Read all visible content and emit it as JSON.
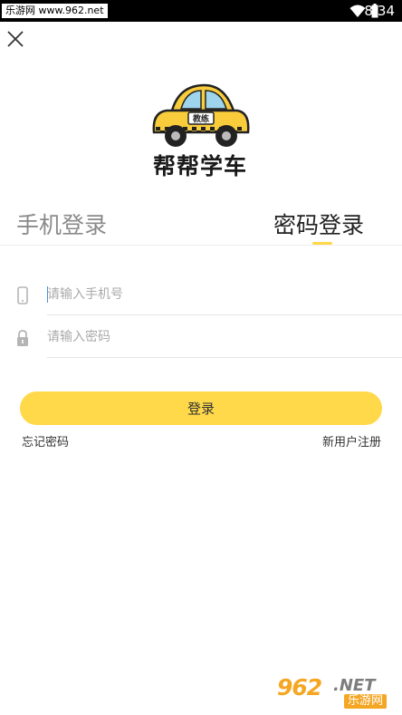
{
  "status_bar": {
    "source_label": "乐游网 www.962.net",
    "time": "8:34"
  },
  "logo": {
    "car_sign": "教练",
    "title": "帮帮学车"
  },
  "tabs": [
    {
      "label": "手机登录",
      "active": false
    },
    {
      "label": "密码登录",
      "active": true
    }
  ],
  "form": {
    "phone_placeholder": "请输入手机号",
    "phone_value": "",
    "password_placeholder": "请输入密码",
    "password_value": ""
  },
  "actions": {
    "login_label": "登录",
    "forgot_password": "忘记密码",
    "register": "新用户注册"
  },
  "watermark": {
    "number": "962",
    "domain": ".NET",
    "name": "乐游网"
  },
  "colors": {
    "accent": "#ffd94a",
    "status_bar": "#000000",
    "car_body": "#f9cc3c",
    "inactive_tab": "#8a8a8a",
    "watermark_orange": "#f5a623"
  },
  "icons": {
    "status_bar": [
      "wifi-icon",
      "battery-icon"
    ],
    "header": "close-icon",
    "phone_field": "smartphone-icon",
    "password_field": "lock-icon"
  }
}
